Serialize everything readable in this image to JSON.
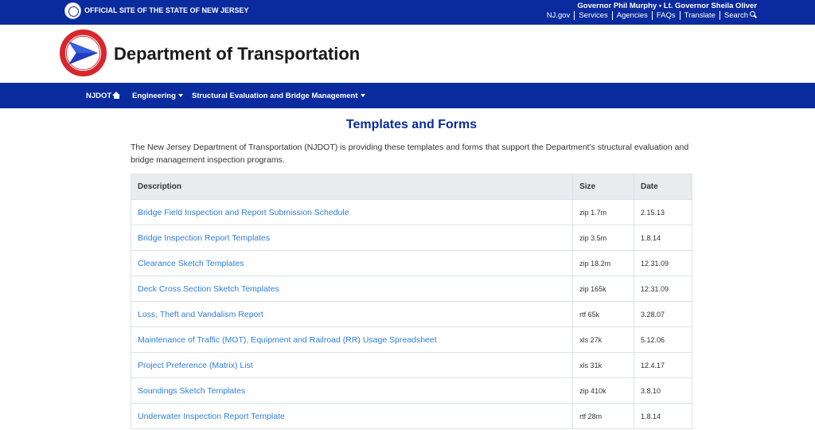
{
  "topbar": {
    "official_site": "OFFICIAL SITE OF THE STATE OF NEW JERSEY",
    "governor": "Governor Phil Murphy • Lt. Governor Sheila Oliver",
    "links": [
      "NJ.gov",
      "Services",
      "Agencies",
      "FAQs",
      "Translate",
      "Search"
    ]
  },
  "header": {
    "title": "Department of Transportation"
  },
  "nav": {
    "home": "NJDOT",
    "engineering": "Engineering",
    "structural": "Structural Evaluation and Bridge Management"
  },
  "main": {
    "title": "Templates and Forms",
    "intro": "The New Jersey Department of Transportation (NJDOT) is providing these templates and forms that support the Department's structural evaluation and bridge management inspection programs.",
    "table": {
      "headers": [
        "Description",
        "Size",
        "Date"
      ],
      "rows": [
        [
          "Bridge Field Inspection and Report Submission Schedule",
          "zip 1.7m",
          "2.15.13"
        ],
        [
          "Bridge Inspection Report Templates",
          "zip 3.5m",
          "1.8.14"
        ],
        [
          "Clearance Sketch Templates",
          "zip 18.2m",
          "12.31.09"
        ],
        [
          "Deck Cross Section Sketch Templates",
          "zip 165k",
          "12.31.09"
        ],
        [
          "Loss, Theft and Vandalism Report",
          "rtf 65k",
          "3.28.07"
        ],
        [
          "Maintenance of Traffic (MOT), Equipment and Railroad (RR) Usage Spreadsheet",
          "xls 27k",
          "5.12.06"
        ],
        [
          "Project Preference (Matrix) List",
          "xls 31k",
          "12.4.17"
        ],
        [
          "Soundings Sketch Templates",
          "zip 410k",
          "3.8.10"
        ],
        [
          "Underwater Inspection Report Template",
          "rtf 28m",
          "1.8.14"
        ]
      ]
    }
  },
  "colors": {
    "brand_blue": "#0a2b9e",
    "link_blue": "#2e7fd9",
    "logo_red": "#d8262c"
  }
}
